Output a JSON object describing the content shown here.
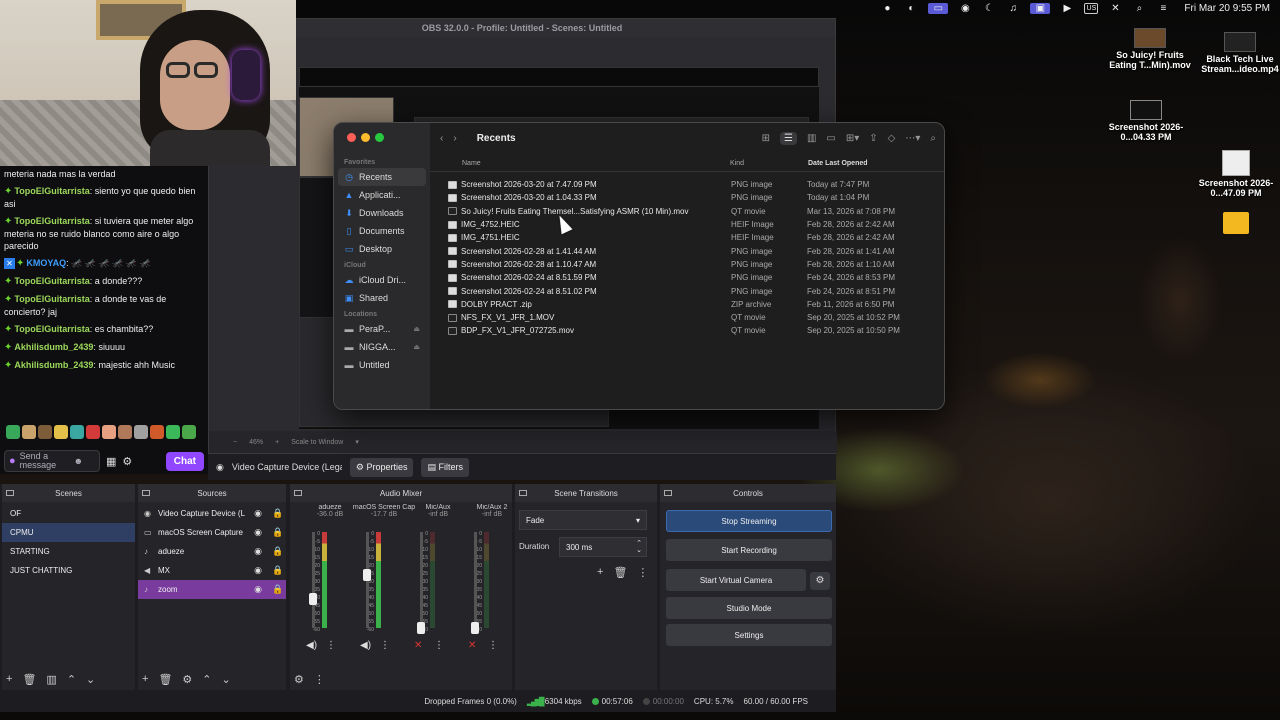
{
  "menubar": {
    "us_label": "US",
    "datetime": "Fri Mar 20  9:55 PM"
  },
  "desktop_icons": [
    {
      "label": "So Juicy! Fruits Eating T...Min).mov",
      "type": "video"
    },
    {
      "label": "Black Tech Live Stream...ideo.mp4",
      "type": "video"
    },
    {
      "label": "Screenshot 2026-0...04.33 PM",
      "type": "image"
    },
    {
      "label": "Screenshot 2026-0...47.09 PM",
      "type": "document"
    },
    {
      "label": "",
      "type": "folder"
    }
  ],
  "chat": {
    "messages": [
      {
        "user": "",
        "text": "meteria nada mas la verdad"
      },
      {
        "user": "TopoElGuitarrista",
        "text": "siento yo que quedo bien asi"
      },
      {
        "user": "TopoElGuitarrista",
        "text": "si tuviera que meter algo meteria no se ruido blanco como aire o algo parecido"
      },
      {
        "user": "KMOYAQ",
        "text": "🦟 🦟 🦟 🦟 🦟 🦟",
        "badge": true
      },
      {
        "user": "TopoElGuitarrista",
        "text": "a donde???"
      },
      {
        "user": "TopoElGuitarrista",
        "text": "a donde te vas de concierto? jaj"
      },
      {
        "user": "TopoElGuitarrista",
        "text": "es chambita??"
      },
      {
        "user": "Akhilisdumb_2439",
        "text": "siuuuu"
      },
      {
        "user": "Akhilisdumb_2439",
        "text": "majestic ahh Music"
      }
    ],
    "input_placeholder": "Send a message",
    "send_label": "Chat"
  },
  "obs": {
    "window_title": "OBS 32.0.0 - Profile: Untitled - Scenes: Untitled",
    "preview_zoom": "46%",
    "scale_label": "Scale to Window",
    "source_toolbar": {
      "source_name": "Video Capture Device (Legacy)",
      "properties_label": "Properties",
      "filters_label": "Filters"
    },
    "docks": {
      "scenes_title": "Scenes",
      "sources_title": "Sources",
      "mixer_title": "Audio Mixer",
      "transitions_title": "Scene Transitions",
      "controls_title": "Controls"
    },
    "scenes": [
      "OF",
      "CPMU",
      "STARTING",
      "JUST CHATTING"
    ],
    "selected_scene": "CPMU",
    "sources": [
      {
        "name": "Video Capture Device (L",
        "icon": "camera-icon"
      },
      {
        "name": "macOS Screen Capture",
        "icon": "monitor-icon"
      },
      {
        "name": "adueze",
        "icon": "mic-icon"
      },
      {
        "name": "MX",
        "icon": "speaker-icon"
      },
      {
        "name": "zoom",
        "icon": "mic-icon"
      }
    ],
    "mixer_channels": [
      {
        "name": "adueze",
        "db": "-36.0 dB",
        "level": 0.3,
        "muted": false
      },
      {
        "name": "macOS Screen Cap",
        "db": "-17.7 dB",
        "level": 0.55,
        "muted": false
      },
      {
        "name": "Mic/Aux",
        "db": "-inf dB",
        "level": 0.0,
        "muted": true
      },
      {
        "name": "Mic/Aux 2",
        "db": "-inf dB",
        "level": 0.0,
        "muted": true
      }
    ],
    "mixer_scale": [
      "0",
      "-5",
      "-10",
      "-15",
      "-20",
      "-25",
      "-30",
      "-35",
      "-40",
      "-45",
      "-50",
      "-55",
      "-60"
    ],
    "transition": {
      "type": "Fade",
      "duration_label": "Duration",
      "duration": "300 ms"
    },
    "controls": {
      "stop_streaming": "Stop Streaming",
      "start_recording": "Start Recording",
      "start_virtual_camera": "Start Virtual Camera",
      "studio_mode": "Studio Mode",
      "settings": "Settings"
    },
    "status": {
      "dropped_frames": "Dropped Frames 0 (0.0%)",
      "bitrate": "6304 kbps",
      "stream_time": "00:57:06",
      "record_time": "00:00:00",
      "cpu": "CPU: 5.7%",
      "fps": "60.00 / 60.00 FPS"
    }
  },
  "finder": {
    "title": "Recents",
    "sidebar": {
      "favorites_header": "Favorites",
      "favorites": [
        {
          "label": "Recents",
          "icon": "clock-icon",
          "active": true
        },
        {
          "label": "Applicati...",
          "icon": "apps-icon"
        },
        {
          "label": "Downloads",
          "icon": "download-icon"
        },
        {
          "label": "Documents",
          "icon": "document-icon"
        },
        {
          "label": "Desktop",
          "icon": "desktop-icon"
        }
      ],
      "icloud_header": "iCloud",
      "icloud": [
        {
          "label": "iCloud Dri...",
          "icon": "cloud-icon"
        },
        {
          "label": "Shared",
          "icon": "shared-folder-icon"
        }
      ],
      "locations_header": "Locations",
      "locations": [
        {
          "label": "PeraP...",
          "icon": "drive-icon",
          "eject": true
        },
        {
          "label": "NIGGA...",
          "icon": "drive-icon",
          "eject": true
        },
        {
          "label": "Untitled",
          "icon": "drive-icon",
          "eject": false
        }
      ]
    },
    "columns": {
      "name": "Name",
      "kind": "Kind",
      "date": "Date Last Opened"
    },
    "files": [
      {
        "name": "Screenshot 2026-03-20 at 7.47.09 PM",
        "kind": "PNG image",
        "date": "Today at 7:47 PM",
        "type": "img"
      },
      {
        "name": "Screenshot 2026-03-20 at 1.04.33 PM",
        "kind": "PNG image",
        "date": "Today at 1:04 PM",
        "type": "img"
      },
      {
        "name": "So Juicy! Fruits Eating Themsel...Satisfying ASMR (10 Min).mov",
        "kind": "QT movie",
        "date": "Mar 13, 2026 at 7:08 PM",
        "type": "mov"
      },
      {
        "name": "IMG_4752.HEIC",
        "kind": "HEIF Image",
        "date": "Feb 28, 2026 at 2:42 AM",
        "type": "img"
      },
      {
        "name": "IMG_4751.HEIC",
        "kind": "HEIF Image",
        "date": "Feb 28, 2026 at 2:42 AM",
        "type": "img"
      },
      {
        "name": "Screenshot 2026-02-28 at 1.41.44 AM",
        "kind": "PNG image",
        "date": "Feb 28, 2026 at 1:41 AM",
        "type": "img"
      },
      {
        "name": "Screenshot 2026-02-28 at 1.10.47 AM",
        "kind": "PNG image",
        "date": "Feb 28, 2026 at 1:10 AM",
        "type": "img"
      },
      {
        "name": "Screenshot 2026-02-24 at 8.51.59 PM",
        "kind": "PNG image",
        "date": "Feb 24, 2026 at 8:53 PM",
        "type": "img"
      },
      {
        "name": "Screenshot 2026-02-24 at 8.51.02 PM",
        "kind": "PNG image",
        "date": "Feb 24, 2026 at 8:51 PM",
        "type": "img"
      },
      {
        "name": "DOLBY PRACT .zip",
        "kind": "ZIP archive",
        "date": "Feb 11, 2026 at 6:50 PM",
        "type": "zip"
      },
      {
        "name": "NFS_FX_V1_JFR_1.MOV",
        "kind": "QT movie",
        "date": "Sep 20, 2025 at 10:52 PM",
        "type": "mov"
      },
      {
        "name": "BDP_FX_V1_JFR_072725.mov",
        "kind": "QT movie",
        "date": "Sep 20, 2025 at 10:50 PM",
        "type": "mov"
      }
    ]
  },
  "colors": {
    "twitch_purple": "#9147ff",
    "chat_user_green": "#9dd95b",
    "obs_selected_scene": "#2f3e63",
    "obs_selected_source": "#7a3b9e",
    "finder_accent": "#3d8ef7"
  }
}
